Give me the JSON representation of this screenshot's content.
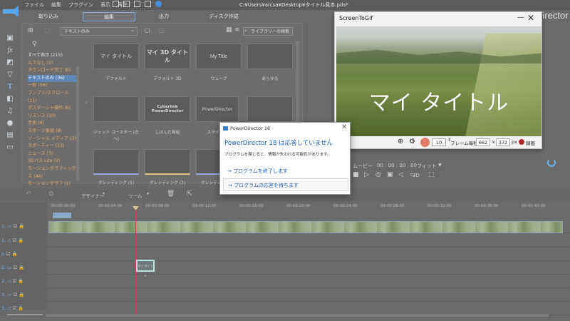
{
  "window": {
    "menu": [
      "ファイル",
      "編集",
      "プラグイン",
      "表示",
      "再生"
    ],
    "path": "C:¥Users¥arcsa¥Desktop¥タイトル見本.pds*",
    "brand": "Director"
  },
  "modes": {
    "import": "取り込み",
    "edit": "編集",
    "output": "出力",
    "disc": "ディスク作成"
  },
  "library": {
    "dropdown": "テキストのみ",
    "search_placeholder": "ライブラリーの検索",
    "categories": [
      "すべて表示 (215)",
      "ムスなし (1)",
      "ダウンロード完了 (6)",
      "テキストのみ (36)",
      "一般 (56)",
      "フンブリ/スクロール (11)",
      "ポスターシャ操作 (6)",
      "リスンス (10)",
      "手術 (6)",
      "スポーツ番組 (8)",
      "ソーシャル メディア (3)",
      "スポーティー (13)",
      "ニュース (7)",
      "3Dパス-Lite (2)",
      "モーショングラフィックス (44)",
      "モーショングラフ (1)"
    ],
    "thumbnails": [
      {
        "title": "マイ タイトル",
        "caption": "デフォルト"
      },
      {
        "title": "マイ 3D タイトル",
        "caption": "デフォルト 3D"
      },
      {
        "title": "My Title",
        "caption": "ウェーブ"
      },
      {
        "title": "",
        "caption": "あらゆる"
      },
      {
        "title": "",
        "caption": "ジェット コースター (左へ)"
      },
      {
        "title": "Cyberlink PowerDirector",
        "caption": "しぼんだ風船"
      },
      {
        "title": "PowerDirector",
        "caption": "スライド"
      },
      {
        "title": "",
        "caption": ""
      },
      {
        "title": "",
        "caption": "グレンディング (1)"
      },
      {
        "title": "",
        "caption": "グレンディング (2)"
      },
      {
        "title": "",
        "caption": "グレンディング (3)"
      },
      {
        "title": "",
        "caption": ""
      }
    ]
  },
  "screentogif": {
    "title": "ScreenToGif",
    "overlay_title": "マイ タイトル",
    "fps": "10",
    "fps_label": "フレーム毎秒",
    "width": "662",
    "height": "372",
    "unit": "px",
    "record_label": "録画"
  },
  "dialog": {
    "app_name": "PowerDirector 18",
    "heading": "PowerDirector 18 は応答していません",
    "message": "プログラムを閉じると、情報が失われる可能性があります。",
    "option_close": "プログラムを終了します",
    "option_wait": "プログラムの応答を待ちます"
  },
  "preview": {
    "mode": "ムービー",
    "timecode": "00 : 00 : 00 . 00",
    "fit": "フィット",
    "three_d": "3D"
  },
  "timeline": {
    "designer": "デザイナー",
    "tool": "ツール",
    "ruler": [
      "00:00:00:00",
      "00:00:04:00",
      "00:00:08:00",
      "00:00:12:00",
      "00:00:16:00",
      "00:00:20:00",
      "00:00:24:00",
      "00:00:28:00",
      "00:00:32:00",
      "00:00:36:00",
      "00:00:40:00"
    ],
    "tracks": [
      "1.",
      "1.",
      "fx",
      "2.",
      "2.",
      "3.",
      "3."
    ],
    "clip_text": "マイ タイトル"
  }
}
